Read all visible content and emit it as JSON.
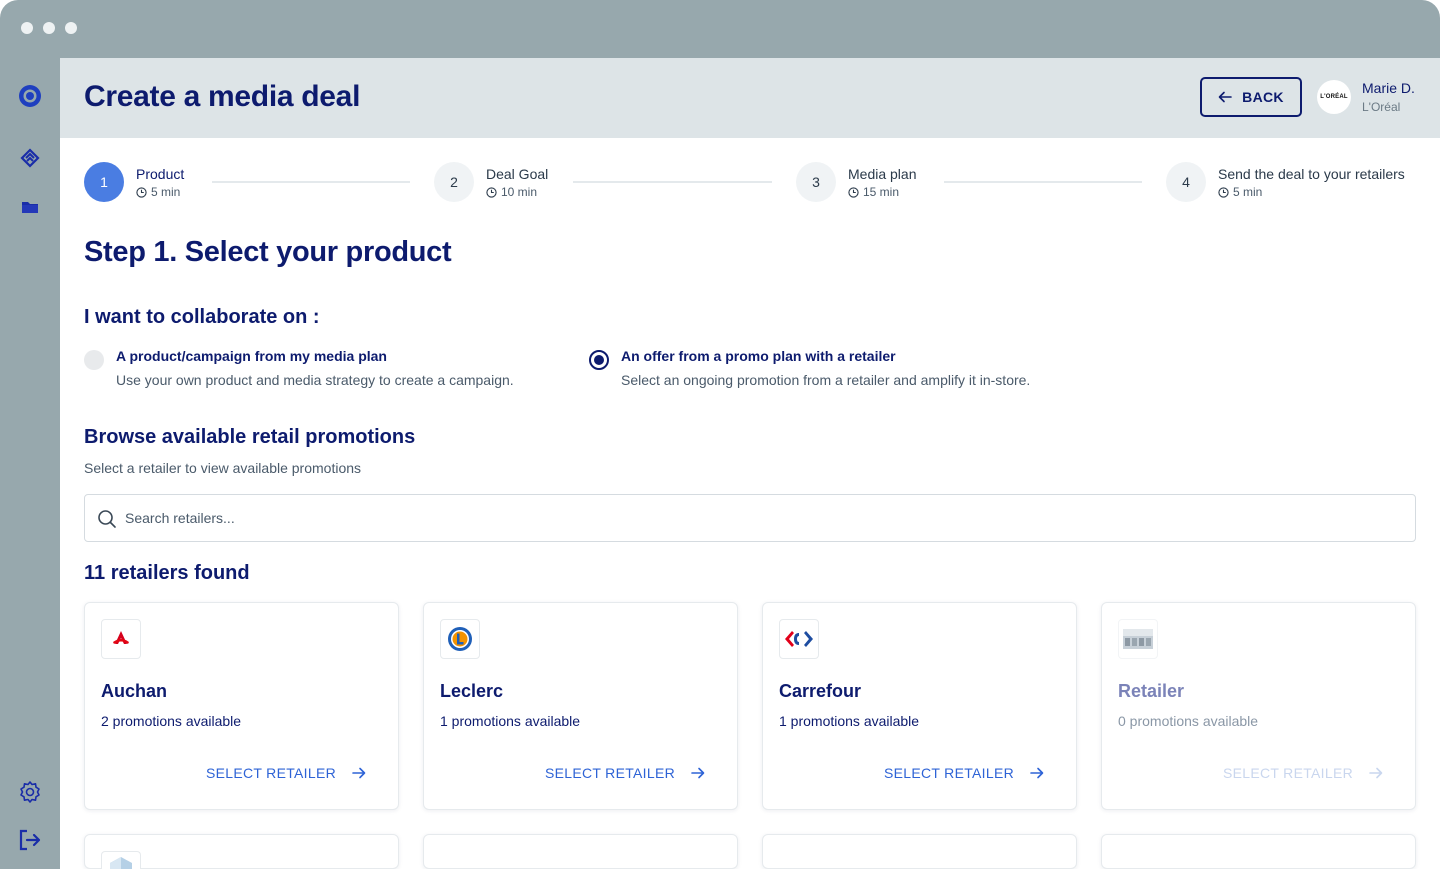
{
  "header": {
    "title": "Create a media deal",
    "back_label": "BACK",
    "user": {
      "name": "Marie D.",
      "org": "L'Oréal",
      "avatar_text": "L'ORÉAL"
    }
  },
  "stepper": {
    "steps": [
      {
        "number": "1",
        "label": "Product",
        "time": "5 min",
        "active": true
      },
      {
        "number": "2",
        "label": "Deal Goal",
        "time": "10 min",
        "active": false
      },
      {
        "number": "3",
        "label": "Media plan",
        "time": "15 min",
        "active": false
      },
      {
        "number": "4",
        "label": "Send the deal to your retailers",
        "time": "5 min",
        "active": false
      }
    ]
  },
  "main": {
    "step_heading": "Step 1. Select your product",
    "collab_heading": "I want to collaborate on :",
    "options": [
      {
        "title": "A product/campaign from my media plan",
        "description": "Use your own product and media strategy to create a campaign.",
        "selected": false
      },
      {
        "title": "An offer from a promo plan with a retailer",
        "description": "Select an ongoing promotion from a retailer and amplify it in-store.",
        "selected": true
      }
    ],
    "browse_heading": "Browse available retail promotions",
    "browse_sub": "Select a retailer to view available promotions",
    "search": {
      "placeholder": "Search retailers..."
    },
    "found_heading": "11 retailers found",
    "retailers": [
      {
        "name": "Auchan",
        "promotions": "2 promotions available",
        "action": "SELECT RETAILER",
        "disabled": false
      },
      {
        "name": "Leclerc",
        "promotions": "1 promotions available",
        "action": "SELECT RETAILER",
        "disabled": false
      },
      {
        "name": "Carrefour",
        "promotions": "1 promotions available",
        "action": "SELECT RETAILER",
        "disabled": false
      },
      {
        "name": "Retailer",
        "promotions": "0 promotions available",
        "action": "SELECT RETAILER",
        "disabled": true
      }
    ]
  },
  "colors": {
    "navy": "#0d1b6e",
    "accent_blue": "#4a7de2",
    "link_blue": "#2e63d6",
    "chrome": "#97a8ad",
    "header_bg": "#dde4e7"
  }
}
